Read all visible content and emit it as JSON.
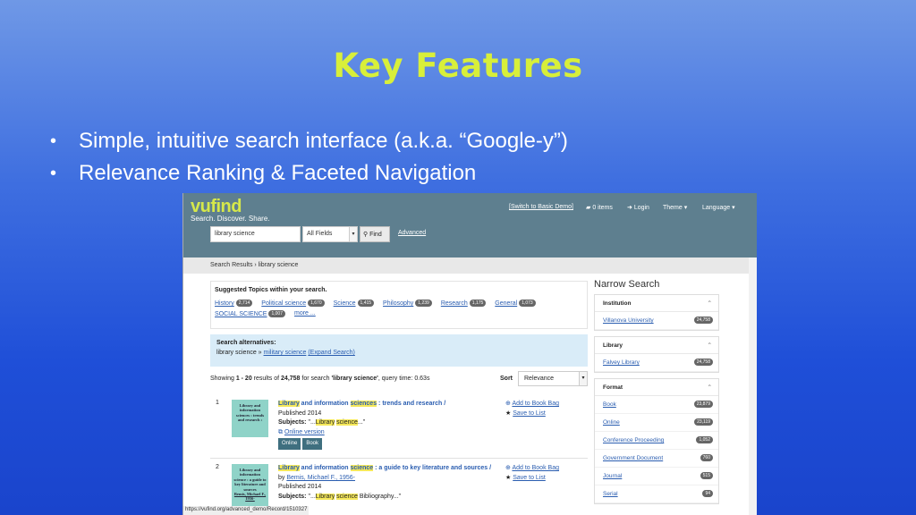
{
  "slide": {
    "title": "Key Features",
    "bullets": [
      "Simple, intuitive search interface (a.k.a. “Google-y”)",
      "Relevance Ranking & Faceted Navigation"
    ],
    "bullet_glyph": "•"
  },
  "vufind": {
    "logo": "vufind",
    "tagline": "Search. Discover. Share.",
    "top_links": {
      "basic": "[Switch to Basic Demo]",
      "items": "0 items",
      "login": "Login",
      "theme": "Theme",
      "language": "Language"
    },
    "search": {
      "value": "library science",
      "field": "All Fields",
      "find": "Find",
      "advanced": "Advanced"
    },
    "breadcrumb": "Search Results › library science",
    "suggested": {
      "heading": "Suggested Topics within your search.",
      "topics": [
        {
          "label": "History",
          "count": "2,714"
        },
        {
          "label": "Political science",
          "count": "1,670"
        },
        {
          "label": "Science",
          "count": "1,415"
        },
        {
          "label": "Philosophy",
          "count": "1,239"
        },
        {
          "label": "Research",
          "count": "1,175"
        },
        {
          "label": "General",
          "count": "1,073"
        },
        {
          "label": "SOCIAL SCIENCE",
          "count": "1,007"
        },
        {
          "label": "more ...",
          "count": ""
        }
      ]
    },
    "alternatives": {
      "heading": "Search alternatives:",
      "query": "library science »",
      "alt": "military science",
      "expand": "(Expand Search)"
    },
    "showing": {
      "prefix": "Showing",
      "range": "1 - 20",
      "mid": "results of",
      "total": "24,758",
      "suffix": "for search",
      "query": "'library science'",
      "time": ", query time: 0.63s"
    },
    "sort": {
      "label": "Sort",
      "value": "Relevance"
    },
    "results": [
      {
        "num": "1",
        "cover": "Library and information sciences : trends and research :",
        "title_parts": [
          "Library",
          " and information ",
          "sciences",
          " : trends and research /"
        ],
        "published": "Published 2014",
        "subjects_label": "Subjects:",
        "subjects": [
          "\"...",
          "Library",
          " ",
          "science",
          "...\""
        ],
        "online": "Online version",
        "formats": [
          "Online",
          "Book"
        ],
        "add": "Add to Book Bag",
        "save": "Save to List"
      },
      {
        "num": "2",
        "cover": "Library and information science : a guide to key literature and sources",
        "cover_author": "Bemis, Michael F., 1956-",
        "title_parts": [
          "Library",
          " and information ",
          "science",
          " : a guide to key literature and sources /"
        ],
        "by_label": "by",
        "author": "Bemis, Michael F., 1956-",
        "published": "Published 2014",
        "subjects_label": "Subjects:",
        "subjects": [
          "\"...",
          "Library",
          " ",
          "science",
          " Bibliography...\""
        ],
        "add": "Add to Book Bag",
        "save": "Save to List"
      }
    ],
    "narrow": {
      "heading": "Narrow Search",
      "facets": [
        {
          "title": "Institution",
          "items": [
            {
              "label": "Villanova University",
              "count": "24,758"
            }
          ]
        },
        {
          "title": "Library",
          "items": [
            {
              "label": "Falvey Library",
              "count": "24,758"
            }
          ]
        },
        {
          "title": "Format",
          "items": [
            {
              "label": "Book",
              "count": "23,879"
            },
            {
              "label": "Online",
              "count": "23,119"
            },
            {
              "label": "Conference Proceeding",
              "count": "1,052"
            },
            {
              "label": "Government Document",
              "count": "760"
            },
            {
              "label": "Journal",
              "count": "515"
            },
            {
              "label": "Serial",
              "count": "94"
            }
          ]
        }
      ]
    },
    "status_url": "https://vufind.org/advanced_demo/Record/1510327"
  }
}
